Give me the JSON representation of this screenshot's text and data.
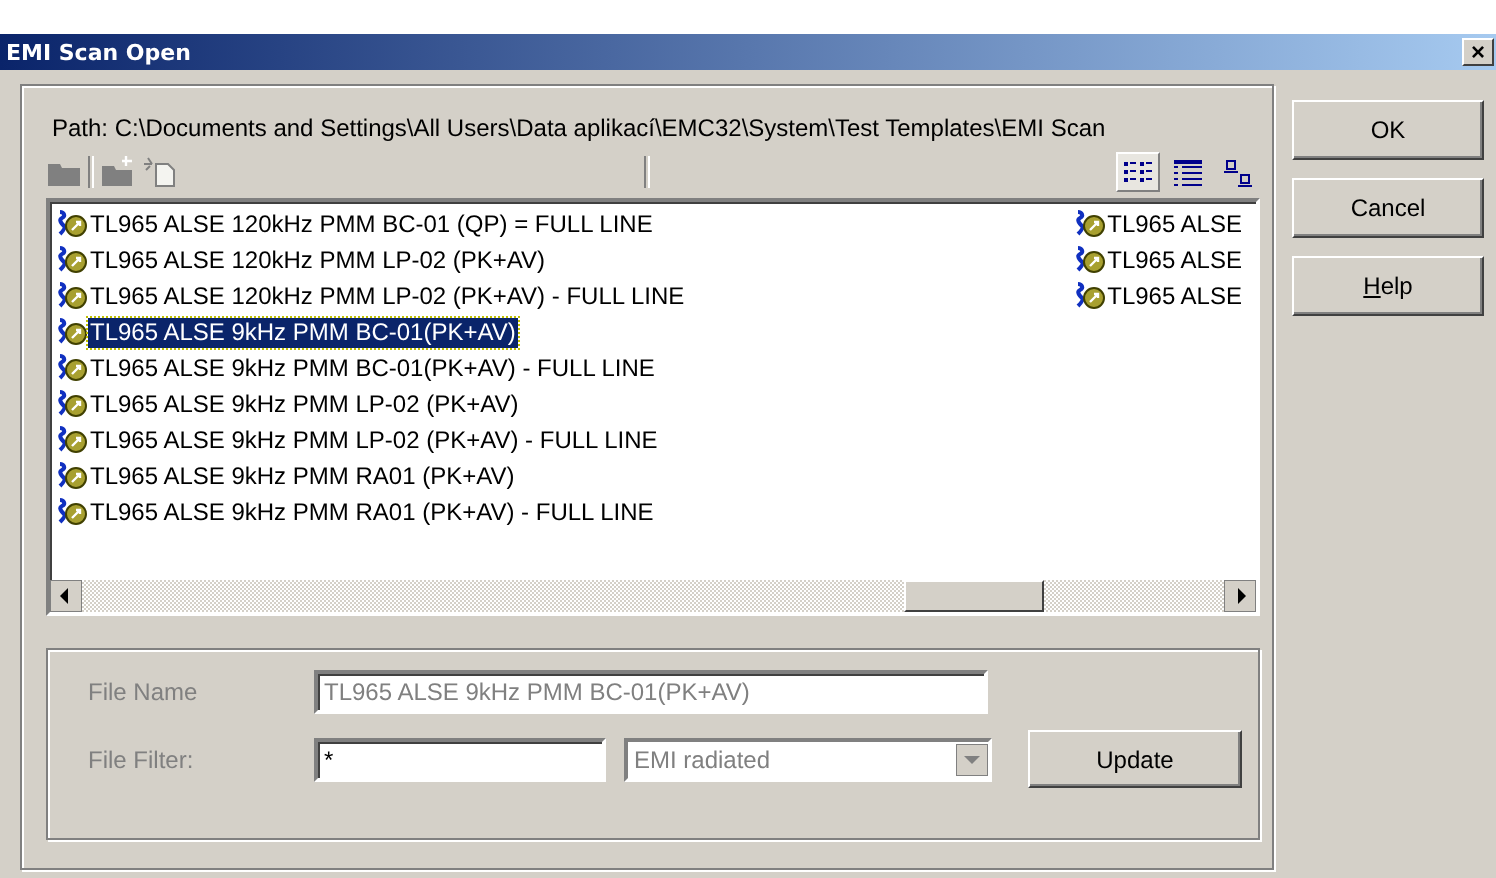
{
  "window": {
    "title": "EMI Scan Open",
    "close": "×"
  },
  "path": "Path: C:\\Documents and Settings\\All Users\\Data aplikací\\EMC32\\System\\Test Templates\\EMI Scan",
  "toolbar": {
    "file_buttons": [
      {
        "kind": "folder",
        "disabled": true
      },
      {
        "kind": "new-folder",
        "disabled": true
      },
      {
        "kind": "new-file",
        "disabled": true
      }
    ],
    "view_buttons": [
      {
        "kind": "list",
        "selected": true
      },
      {
        "kind": "details",
        "selected": false
      },
      {
        "kind": "icons",
        "selected": false
      }
    ]
  },
  "file_list": {
    "columns": [
      [
        {
          "name": "TL965 ALSE 120kHz PMM BC-01 (QP) = FULL LINE",
          "selected": false
        },
        {
          "name": "TL965 ALSE 120kHz PMM LP-02 (PK+AV)",
          "selected": false
        },
        {
          "name": "TL965 ALSE 120kHz PMM LP-02 (PK+AV) - FULL LINE",
          "selected": false
        },
        {
          "name": "TL965 ALSE 9kHz PMM BC-01(PK+AV)",
          "selected": true
        },
        {
          "name": "TL965 ALSE 9kHz PMM BC-01(PK+AV) - FULL LINE",
          "selected": false
        },
        {
          "name": "TL965 ALSE 9kHz PMM LP-02 (PK+AV)",
          "selected": false
        },
        {
          "name": "TL965 ALSE 9kHz PMM LP-02 (PK+AV) - FULL LINE",
          "selected": false
        },
        {
          "name": "TL965 ALSE 9kHz PMM RA01 (PK+AV)",
          "selected": false
        },
        {
          "name": "TL965 ALSE 9kHz PMM RA01 (PK+AV) - FULL LINE",
          "selected": false
        }
      ],
      [
        {
          "name": "TL965 ALSE",
          "selected": false
        },
        {
          "name": "TL965 ALSE",
          "selected": false
        },
        {
          "name": "TL965 ALSE",
          "selected": false
        }
      ]
    ]
  },
  "file_name": {
    "label": "File Name",
    "value": "TL965 ALSE 9kHz PMM BC-01(PK+AV)",
    "disabled": true
  },
  "file_filter": {
    "label": "File Filter:",
    "value": "*",
    "type": "EMI radiated",
    "type_disabled": true
  },
  "update_button": "Update",
  "buttons": [
    {
      "label": "OK",
      "mnemonic": false
    },
    {
      "label": "Cancel",
      "mnemonic": false
    },
    {
      "label": "Help",
      "mnemonic": true
    }
  ]
}
